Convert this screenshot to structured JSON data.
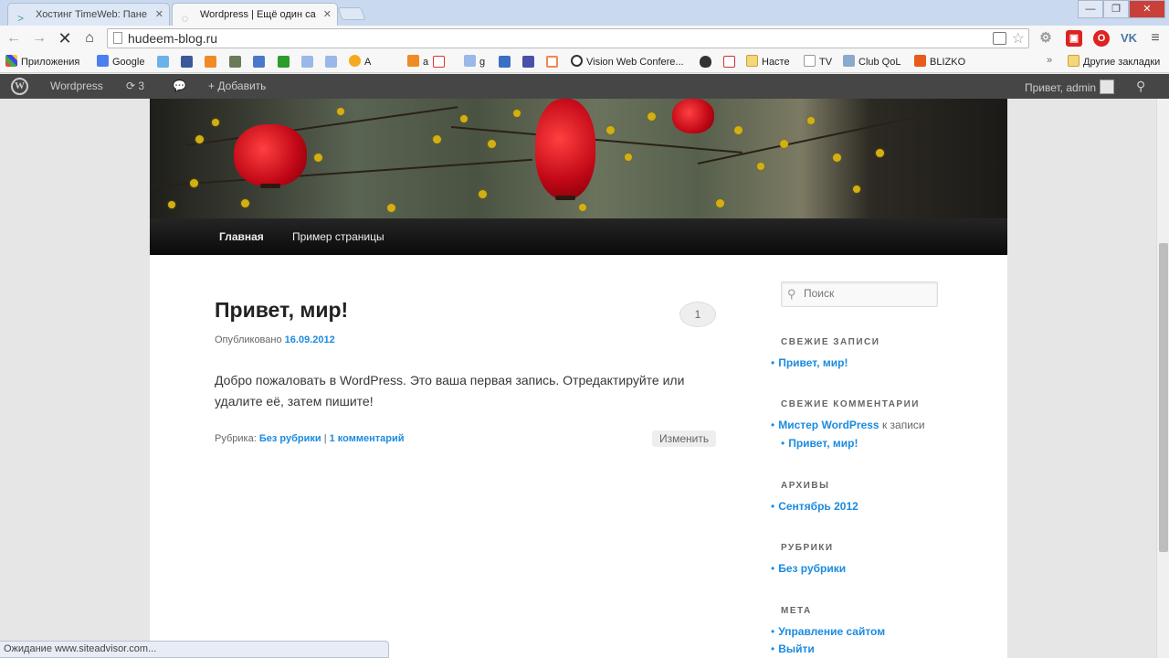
{
  "browser": {
    "tabs": [
      {
        "title": "Хостинг TimeWeb: Пане"
      },
      {
        "title": "Wordpress | Ещё один са"
      }
    ],
    "url": "hudeem-blog.ru",
    "bookmarks": [
      {
        "label": "Приложения"
      },
      {
        "label": "Google"
      },
      {
        "label": "A"
      },
      {
        "label": "a"
      },
      {
        "label": "g"
      },
      {
        "label": "Vision Web Confere..."
      },
      {
        "label": "Насте"
      },
      {
        "label": "TV"
      },
      {
        "label": "Club QoL"
      },
      {
        "label": "BLIZKO"
      },
      {
        "label": "Другие закладки"
      }
    ],
    "window_controls": {
      "minimize": "—",
      "maximize": "❐",
      "close": "✕"
    },
    "status": "Ожидание www.siteadvisor.com..."
  },
  "adminbar": {
    "site": "Wordpress",
    "updates": "3",
    "add_new": "Добавить",
    "greeting": "Привет, admin"
  },
  "site": {
    "nav": [
      "Главная",
      "Пример страницы"
    ]
  },
  "post": {
    "title": "Привет, мир!",
    "comment_count": "1",
    "published_label": "Опубликовано",
    "date": "16.09.2012",
    "content": "Добро пожаловать в WordPress. Это ваша первая запись. Отредактируйте или удалите её, затем пишите!",
    "category_label": "Рубрика:",
    "category": "Без рубрики",
    "separator": "|",
    "comments_link": "1 комментарий",
    "edit": "Изменить"
  },
  "sidebar": {
    "search_placeholder": "Поиск",
    "recent_posts_title": "СВЕЖИЕ ЗАПИСИ",
    "recent_posts": [
      "Привет, мир!"
    ],
    "recent_comments_title": "СВЕЖИЕ КОММЕНТАРИИ",
    "recent_comment": {
      "author": "Мистер WordPress",
      "on": "к записи",
      "post": "Привет, мир!"
    },
    "archives_title": "АРХИВЫ",
    "archives": [
      "Сентябрь 2012"
    ],
    "categories_title": "РУБРИКИ",
    "categories": [
      "Без рубрики"
    ],
    "meta_title": "МЕТА",
    "meta": [
      "Управление сайтом",
      "Выйти"
    ]
  }
}
